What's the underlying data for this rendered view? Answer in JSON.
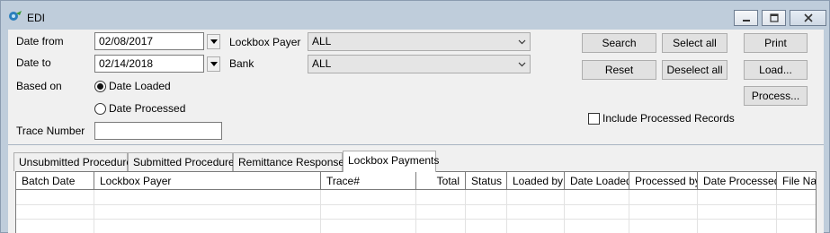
{
  "window": {
    "title": "EDI"
  },
  "filters": {
    "date_from_label": "Date from",
    "date_from_value": "02/08/2017",
    "date_to_label": "Date to",
    "date_to_value": "02/14/2018",
    "based_on_label": "Based on",
    "based_on_options": [
      "Date Loaded",
      "Date Processed"
    ],
    "based_on_selected": "Date Loaded",
    "trace_number_label": "Trace Number",
    "trace_number_value": "",
    "lockbox_payer_label": "Lockbox Payer",
    "lockbox_payer_value": "ALL",
    "bank_label": "Bank",
    "bank_value": "ALL",
    "include_processed_label": "Include Processed Records",
    "include_processed_checked": false
  },
  "buttons": {
    "search": "Search",
    "reset": "Reset",
    "select_all": "Select all",
    "deselect_all": "Deselect all",
    "print": "Print",
    "load": "Load...",
    "process": "Process..."
  },
  "tabs": [
    {
      "label": "Unsubmitted Procedures",
      "active": false
    },
    {
      "label": "Submitted Procedures",
      "active": false
    },
    {
      "label": "Remittance Responses",
      "active": false
    },
    {
      "label": "Lockbox Payments",
      "active": true
    }
  ],
  "grid": {
    "columns": [
      "Batch Date",
      "Lockbox Payer",
      "Trace#",
      "Total",
      "Status",
      "Loaded by",
      "Date Loaded",
      "Processed by",
      "Date Processed",
      "File Nar"
    ]
  },
  "colors": {
    "window_frame": "#bfcddb",
    "panel": "#f0f0f0",
    "app_icon": "#2a7fbd"
  },
  "icons": {
    "app": "edi-app-icon",
    "dropdown": "chevron-down-icon",
    "minimize": "minimize-icon",
    "maximize": "maximize-icon",
    "close": "close-icon"
  }
}
